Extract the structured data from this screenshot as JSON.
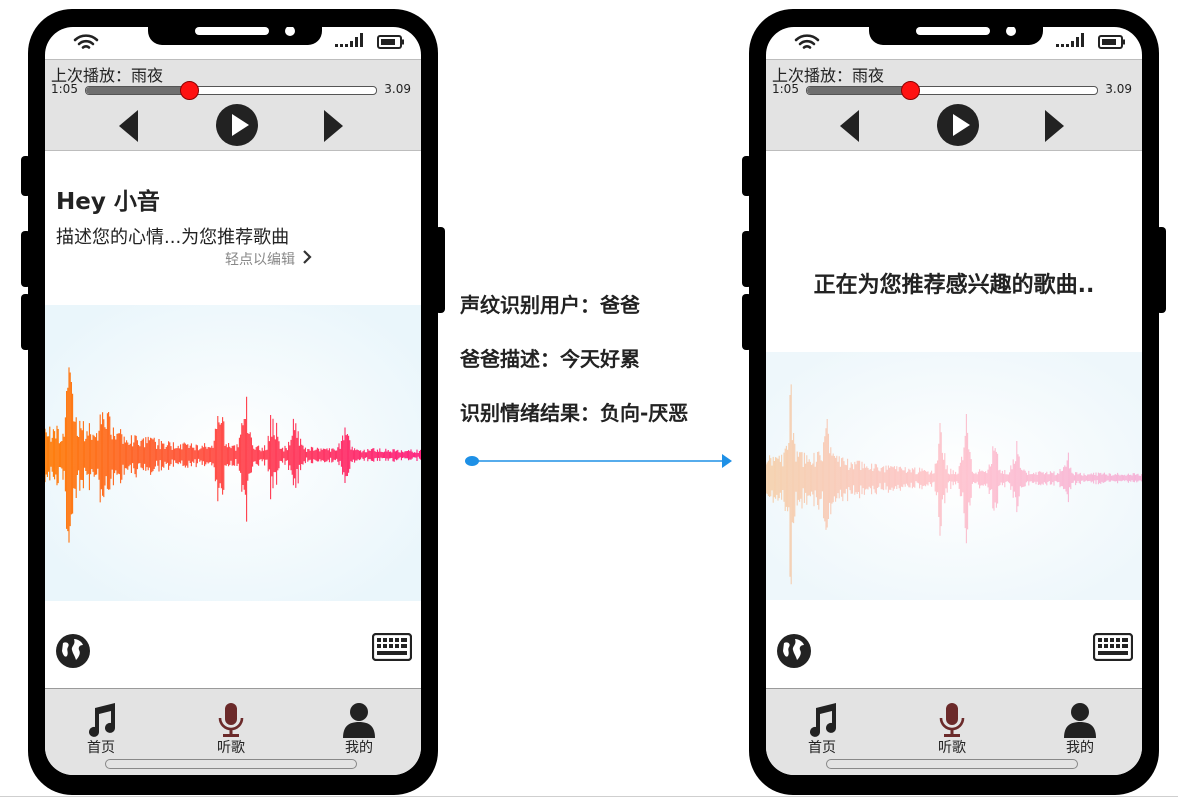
{
  "phones": [
    {
      "player": {
        "last_played": "上次播放：雨夜",
        "time_start": "1:05",
        "time_end": "3.09",
        "progress": 0.35
      },
      "content": {
        "title": "Hey 小音",
        "prompt": "描述您的心情...为您推荐歌曲",
        "edit_link": "轻点以编辑"
      },
      "tabs": [
        {
          "label": "首页",
          "icon": "music-note-icon"
        },
        {
          "label": "听歌",
          "icon": "microphone-icon"
        },
        {
          "label": "我的",
          "icon": "user-icon"
        }
      ]
    },
    {
      "player": {
        "last_played": "上次播放：雨夜",
        "time_start": "1:05",
        "time_end": "3.09",
        "progress": 0.35
      },
      "content": {
        "status": "正在为您推荐感兴趣的歌曲.."
      },
      "tabs": [
        {
          "label": "首页",
          "icon": "music-note-icon"
        },
        {
          "label": "听歌",
          "icon": "microphone-icon"
        },
        {
          "label": "我的",
          "icon": "user-icon"
        }
      ]
    }
  ],
  "annotations": {
    "voiceprint": "声纹识别用户：爸爸",
    "description": "爸爸描述：今天好累",
    "emotion": "识别情绪结果：负向-厌恶"
  },
  "colors": {
    "progress_thumb": "#ff1111",
    "mic_active": "#6b2a2a",
    "arrow": "#1e90e6",
    "wave_start": "#ff7a00",
    "wave_end": "#ff1a7a"
  }
}
